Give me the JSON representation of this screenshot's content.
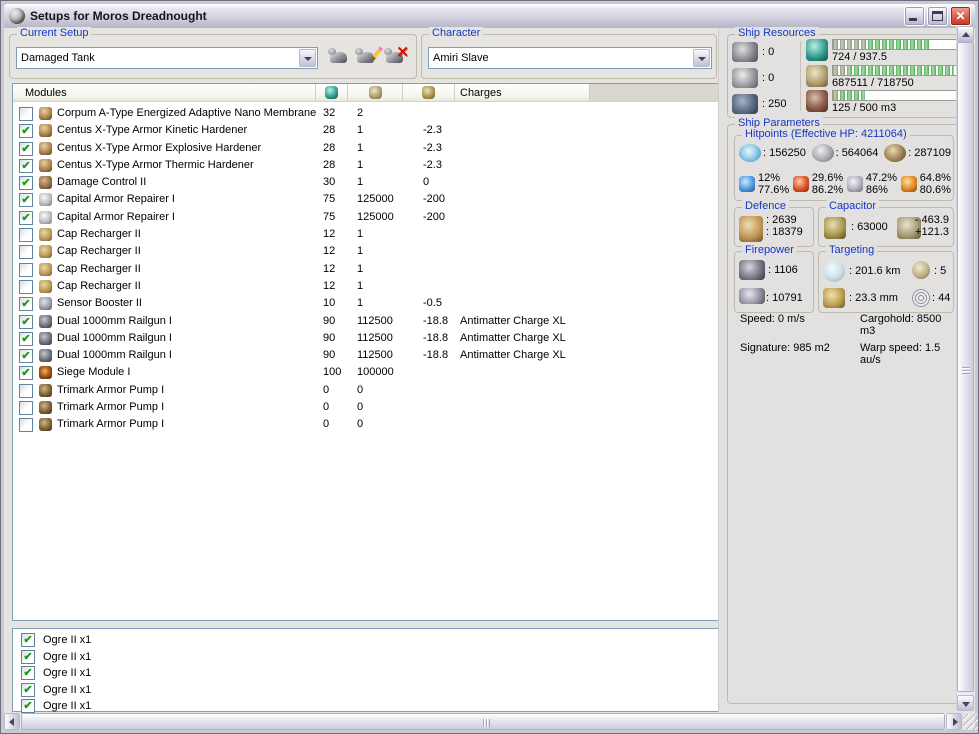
{
  "ui": {
    "check_glyph": "✔"
  },
  "window": {
    "title": "Setups for Moros Dreadnought"
  },
  "setup": {
    "label": "Current Setup",
    "value": "Damaged Tank",
    "buttons": [
      {
        "name": "new-setup-button"
      },
      {
        "name": "edit-setup-button"
      },
      {
        "name": "delete-setup-button"
      }
    ]
  },
  "character": {
    "label": "Character",
    "value": "Amiri Slave"
  },
  "table": {
    "header": {
      "modules": "Modules",
      "charges": "Charges"
    },
    "rows": [
      {
        "checked": false,
        "icon": "nano-membrane",
        "name": "Corpum A-Type Energized Adaptive Nano Membrane",
        "cpu": "32",
        "pg": "2",
        "cap": "",
        "charge": ""
      },
      {
        "checked": true,
        "icon": "armor-hardener",
        "name": "Centus X-Type Armor Kinetic Hardener",
        "cpu": "28",
        "pg": "1",
        "cap": "-2.3",
        "charge": ""
      },
      {
        "checked": true,
        "icon": "armor-hardener",
        "name": "Centus X-Type Armor Explosive Hardener",
        "cpu": "28",
        "pg": "1",
        "cap": "-2.3",
        "charge": ""
      },
      {
        "checked": true,
        "icon": "armor-hardener",
        "name": "Centus X-Type Armor Thermic Hardener",
        "cpu": "28",
        "pg": "1",
        "cap": "-2.3",
        "charge": ""
      },
      {
        "checked": true,
        "icon": "damage-control",
        "name": "Damage Control II",
        "cpu": "30",
        "pg": "1",
        "cap": "0",
        "charge": ""
      },
      {
        "checked": true,
        "icon": "armor-repairer",
        "name": "Capital Armor Repairer I",
        "cpu": "75",
        "pg": "125000",
        "cap": "-200",
        "charge": ""
      },
      {
        "checked": true,
        "icon": "armor-repairer",
        "name": "Capital Armor Repairer I",
        "cpu": "75",
        "pg": "125000",
        "cap": "-200",
        "charge": ""
      },
      {
        "checked": false,
        "icon": "cap-recharger",
        "name": "Cap Recharger II",
        "cpu": "12",
        "pg": "1",
        "cap": "",
        "charge": ""
      },
      {
        "checked": false,
        "icon": "cap-recharger",
        "name": "Cap Recharger II",
        "cpu": "12",
        "pg": "1",
        "cap": "",
        "charge": ""
      },
      {
        "checked": false,
        "icon": "cap-recharger",
        "name": "Cap Recharger II",
        "cpu": "12",
        "pg": "1",
        "cap": "",
        "charge": ""
      },
      {
        "checked": false,
        "icon": "cap-recharger",
        "name": "Cap Recharger II",
        "cpu": "12",
        "pg": "1",
        "cap": "",
        "charge": ""
      },
      {
        "checked": true,
        "icon": "sensor-booster",
        "name": "Sensor Booster II",
        "cpu": "10",
        "pg": "1",
        "cap": "-0.5",
        "charge": ""
      },
      {
        "checked": true,
        "icon": "railgun",
        "name": "Dual 1000mm Railgun I",
        "cpu": "90",
        "pg": "112500",
        "cap": "-18.8",
        "charge": "Antimatter Charge XL"
      },
      {
        "checked": true,
        "icon": "railgun",
        "name": "Dual 1000mm Railgun I",
        "cpu": "90",
        "pg": "112500",
        "cap": "-18.8",
        "charge": "Antimatter Charge XL"
      },
      {
        "checked": true,
        "icon": "railgun",
        "name": "Dual 1000mm Railgun I",
        "cpu": "90",
        "pg": "112500",
        "cap": "-18.8",
        "charge": "Antimatter Charge XL"
      },
      {
        "checked": true,
        "icon": "siege-module",
        "name": "Siege Module I",
        "cpu": "100",
        "pg": "100000",
        "cap": "",
        "charge": ""
      },
      {
        "checked": false,
        "icon": "armor-rig",
        "name": "Trimark Armor Pump I",
        "cpu": "0",
        "pg": "0",
        "cap": "",
        "charge": ""
      },
      {
        "checked": false,
        "icon": "armor-rig",
        "name": "Trimark Armor Pump I",
        "cpu": "0",
        "pg": "0",
        "cap": "",
        "charge": ""
      },
      {
        "checked": false,
        "icon": "armor-rig",
        "name": "Trimark Armor Pump I",
        "cpu": "0",
        "pg": "0",
        "cap": "",
        "charge": ""
      }
    ]
  },
  "drones": {
    "rows": [
      {
        "checked": true,
        "name": "Ogre II x1"
      },
      {
        "checked": true,
        "name": "Ogre II x1"
      },
      {
        "checked": true,
        "name": "Ogre II x1"
      },
      {
        "checked": true,
        "name": "Ogre II x1"
      },
      {
        "checked": true,
        "name": "Ogre II x1"
      }
    ]
  },
  "resources": {
    "label": "Ship Resources",
    "hardpoints": [
      {
        "icon": "turret-hardpoint",
        "value": ": 0"
      },
      {
        "icon": "launcher-hardpoint",
        "value": ": 0"
      },
      {
        "icon": "calibration",
        "value": ": 250"
      }
    ],
    "bars": [
      {
        "icon": "cpu",
        "text": "724 / 937.5",
        "fill": 77,
        "dark": 27
      },
      {
        "icon": "powergrid",
        "text": "687511 / 718750",
        "fill": 96,
        "dark": 13
      },
      {
        "icon": "dronebay",
        "text": "125 / 500 m3",
        "fill": 25,
        "dark": 5
      }
    ]
  },
  "params": {
    "label": "Ship Parameters",
    "hitpoints": {
      "label": "Hitpoints (Effective HP: 4211064)",
      "values": [
        {
          "icon": "shield",
          "value": ": 156250"
        },
        {
          "icon": "armor",
          "value": ": 564064"
        },
        {
          "icon": "structure",
          "value": ": 287109"
        }
      ],
      "resists": [
        {
          "icon": "em",
          "top": "12%",
          "bottom": "77.6%"
        },
        {
          "icon": "thermal",
          "top": "29.6%",
          "bottom": "86.2%"
        },
        {
          "icon": "kinetic",
          "top": "47.2%",
          "bottom": "86%"
        },
        {
          "icon": "explosive",
          "top": "64.8%",
          "bottom": "80.6%"
        }
      ]
    },
    "defence": {
      "label": "Defence",
      "value1": ": 2639",
      "value2": ": 18379"
    },
    "capacitor": {
      "label": "Capacitor",
      "amount": ": 63000",
      "delta_top": "- 463.9",
      "delta_bottom": "+121.3"
    },
    "firepower": {
      "label": "Firepower",
      "turret": ": 1106",
      "missiles": ": 10791"
    },
    "targeting": {
      "label": "Targeting",
      "range": ": 201.6 km",
      "scan_res": ": 23.3 mm",
      "max_targets": ": 5",
      "sensor_strength": ": 44"
    },
    "stats": {
      "speed": "Speed: 0 m/s",
      "cargohold": "Cargohold: 8500 m3",
      "signature": "Signature: 985 m2",
      "warp": "Warp speed: 1.5 au/s"
    }
  }
}
